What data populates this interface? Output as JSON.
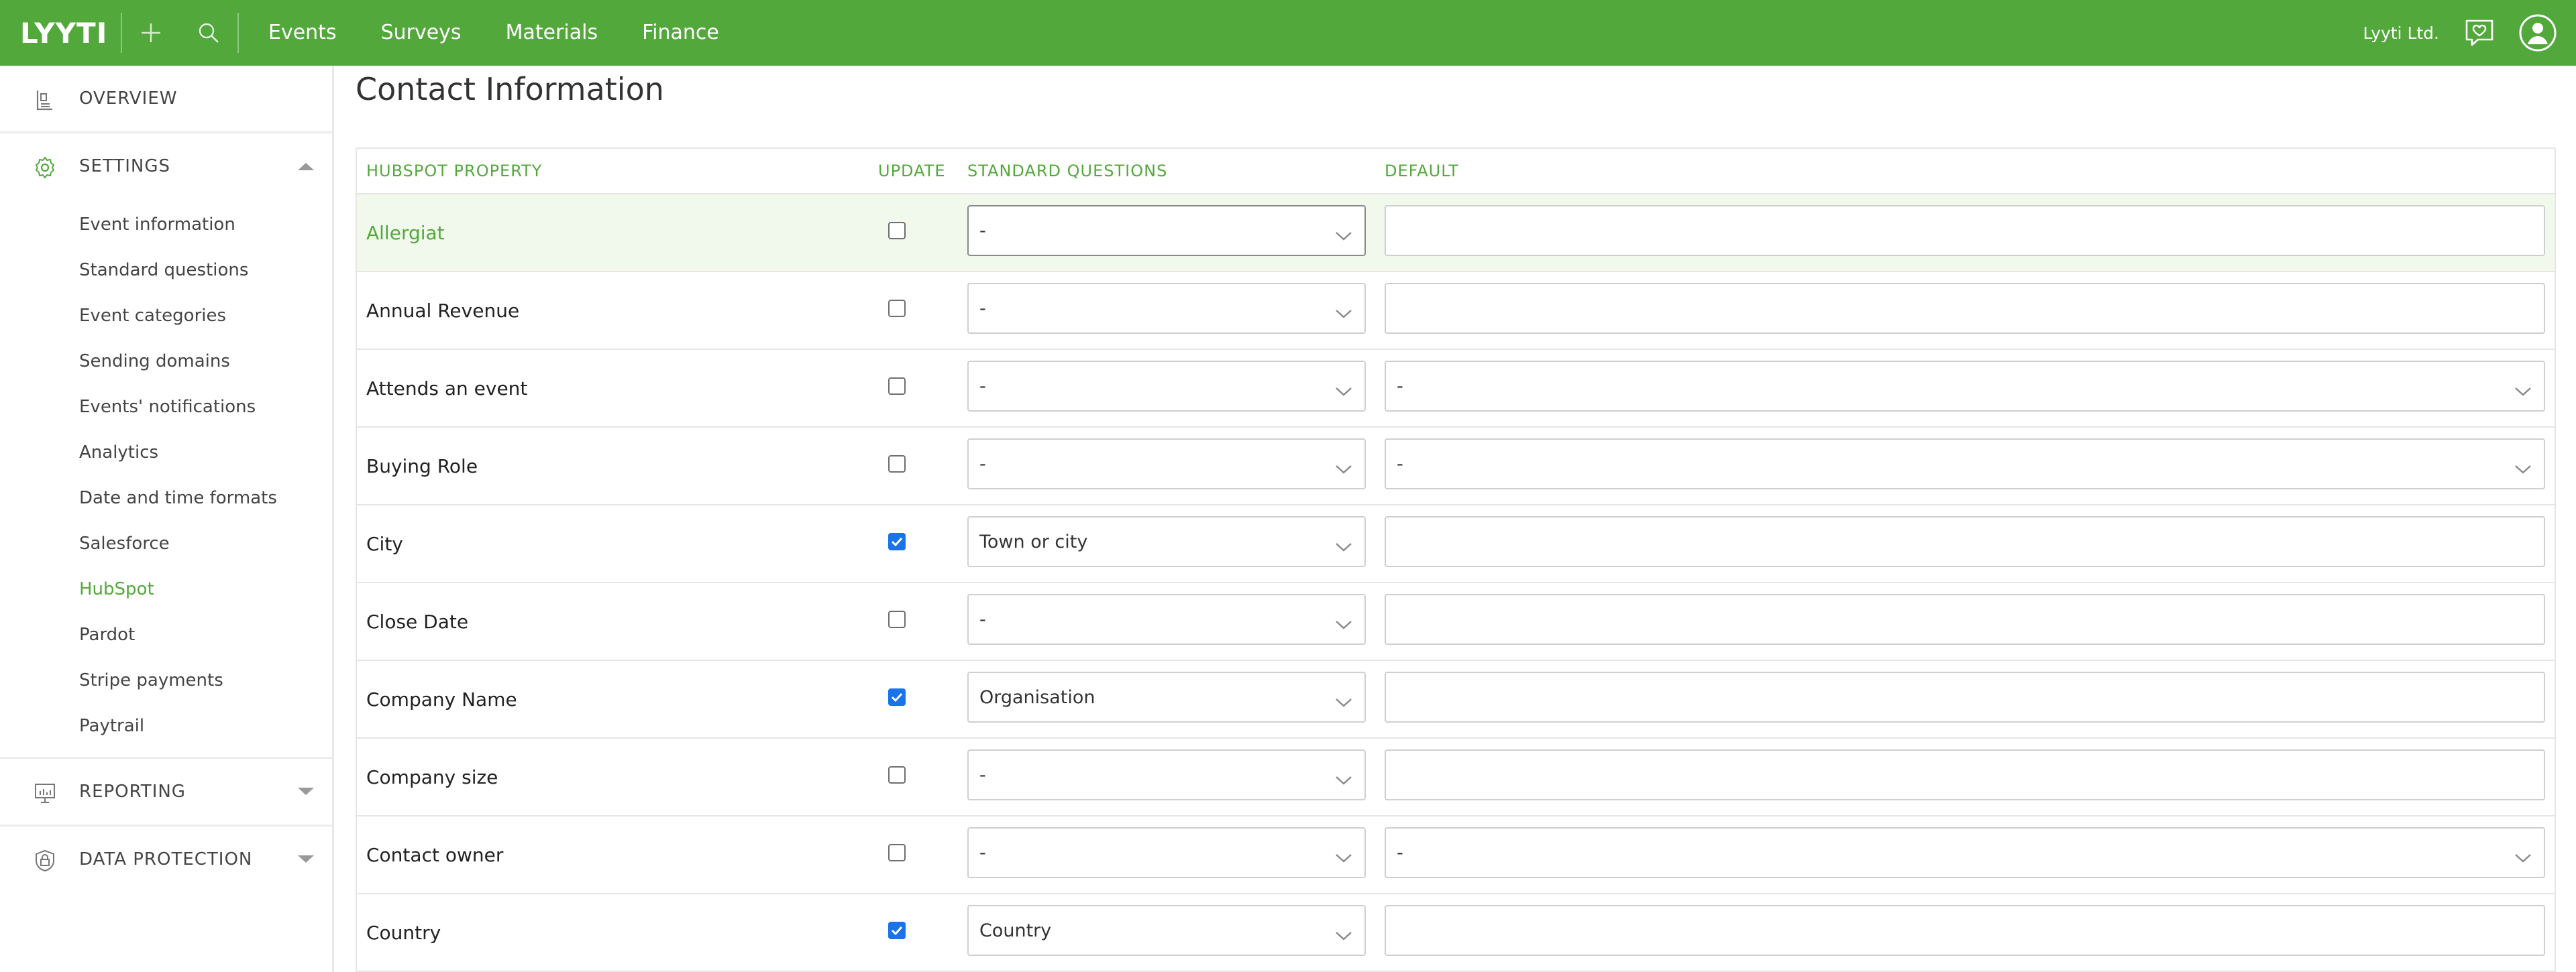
{
  "topbar": {
    "logo": "LYYTI",
    "nav": [
      "Events",
      "Surveys",
      "Materials",
      "Finance"
    ],
    "org_name": "Lyyti Ltd."
  },
  "sidebar": {
    "overview": "OVERVIEW",
    "settings": "SETTINGS",
    "settings_items": [
      "Event information",
      "Standard questions",
      "Event categories",
      "Sending domains",
      "Events' notifications",
      "Analytics",
      "Date and time formats",
      "Salesforce",
      "HubSpot",
      "Pardot",
      "Stripe payments",
      "Paytrail"
    ],
    "active_item": "HubSpot",
    "reporting": "REPORTING",
    "data_protection": "DATA PROTECTION"
  },
  "main": {
    "title": "Contact Information",
    "columns": {
      "property": "HUBSPOT PROPERTY",
      "update": "UPDATE",
      "standard": "STANDARD QUESTIONS",
      "default": "DEFAULT"
    },
    "rows": [
      {
        "property": "Allergiat",
        "update": false,
        "standard": "-",
        "default": ""
      },
      {
        "property": "Annual Revenue",
        "update": false,
        "standard": "-",
        "default": ""
      },
      {
        "property": "Attends an event",
        "update": false,
        "standard": "-",
        "default": "-"
      },
      {
        "property": "Buying Role",
        "update": false,
        "standard": "-",
        "default": "-"
      },
      {
        "property": "City",
        "update": true,
        "standard": "Town or city",
        "default": ""
      },
      {
        "property": "Close Date",
        "update": false,
        "standard": "-",
        "default": ""
      },
      {
        "property": "Company Name",
        "update": true,
        "standard": "Organisation",
        "default": ""
      },
      {
        "property": "Company size",
        "update": false,
        "standard": "-",
        "default": ""
      },
      {
        "property": "Contact owner",
        "update": false,
        "standard": "-",
        "default": "-"
      },
      {
        "property": "Country",
        "update": true,
        "standard": "Country",
        "default": ""
      }
    ]
  },
  "colors": {
    "brand_green": "#53a83c",
    "checkbox_blue": "#1a73e8",
    "row_highlight": "#f0f9ec"
  },
  "icons": {
    "add": "plus-icon",
    "search": "search-icon",
    "chat": "chat-heart-icon",
    "user": "user-avatar-icon",
    "overview": "overview-icon",
    "settings": "gear-icon",
    "reporting": "chart-icon",
    "data_protection": "lock-icon"
  }
}
